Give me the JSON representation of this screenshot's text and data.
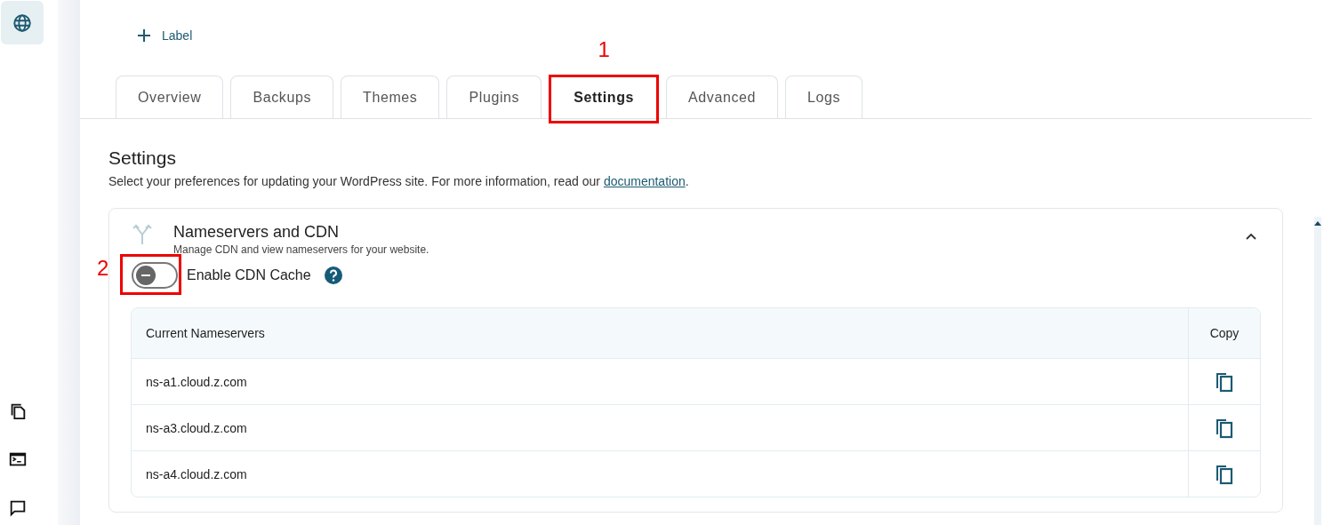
{
  "add_label": {
    "text": "Label"
  },
  "tabs": [
    {
      "label": "Overview",
      "selected": false
    },
    {
      "label": "Backups",
      "selected": false
    },
    {
      "label": "Themes",
      "selected": false
    },
    {
      "label": "Plugins",
      "selected": false
    },
    {
      "label": "Settings",
      "selected": true,
      "annotation": "1"
    },
    {
      "label": "Advanced",
      "selected": false
    },
    {
      "label": "Logs",
      "selected": false
    }
  ],
  "settings": {
    "title": "Settings",
    "description_before": "Select your preferences for updating your WordPress site. For more information, read our ",
    "link": "documentation",
    "description_after": "."
  },
  "panel": {
    "title": "Nameservers and CDN",
    "subtitle": "Manage CDN and view nameservers for your website.",
    "expanded": true,
    "toggle": {
      "label": "Enable CDN Cache",
      "on": false,
      "annotation": "2"
    },
    "table": {
      "columns": [
        "Current Nameservers",
        "Copy"
      ],
      "rows": [
        {
          "nameserver": "ns-a1.cloud.z.com"
        },
        {
          "nameserver": "ns-a3.cloud.z.com"
        },
        {
          "nameserver": "ns-a4.cloud.z.com"
        }
      ]
    }
  }
}
